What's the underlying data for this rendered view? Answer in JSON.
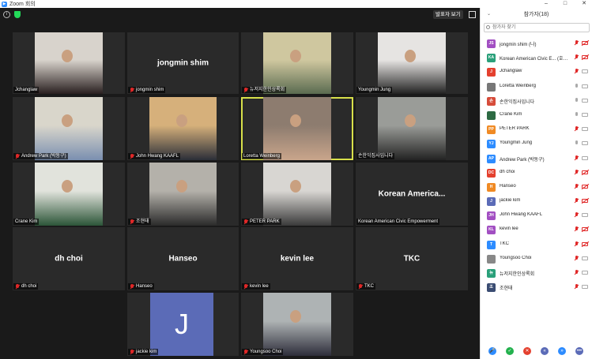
{
  "window": {
    "title": "Zoom 회의",
    "controls": [
      "–",
      "□",
      "✕"
    ]
  },
  "toolbar": {
    "speaker_view_label": "발표자 보기"
  },
  "tiles": [
    {
      "name": "Jchanglaw",
      "big": "",
      "muted": false,
      "photo_color": "#d8d3cc",
      "photo2": "#2a2020"
    },
    {
      "name": "jongmin shim",
      "big": "jongmin shim",
      "muted": true
    },
    {
      "name": "뉴저지한인상록회",
      "big": "",
      "muted": true,
      "photo_color": "#cfc79f",
      "photo2": "#5a6b50"
    },
    {
      "name": "Youngmin Jung",
      "big": "",
      "muted": false,
      "photo_color": "#e6e4e2",
      "photo2": "#222"
    },
    {
      "name": "Andrew Park (박동구)",
      "big": "",
      "muted": true,
      "photo_color": "#d9d6cb",
      "photo2": "#7a8fb0"
    },
    {
      "name": "John Hwang KAAFL",
      "big": "",
      "muted": true,
      "photo_color": "#d6b07b",
      "photo2": "#2a2e38"
    },
    {
      "name": "Loretta Weinberg",
      "big": "",
      "muted": false,
      "photo_color": "#8d7c6f",
      "photo2": "#c9a58b"
    },
    {
      "name": "손한익집사입니다",
      "big": "",
      "muted": false,
      "photo_color": "#9a9c98",
      "photo2": "#222"
    },
    {
      "name": "Crane Kim",
      "big": "",
      "muted": false,
      "photo_color": "#e1e3dc",
      "photo2": "#2c5538"
    },
    {
      "name": "조현태",
      "big": "",
      "muted": true,
      "photo_color": "#b4b1aa",
      "photo2": "#2a2a2a"
    },
    {
      "name": "PETER PARK",
      "big": "",
      "muted": true,
      "photo_color": "#d8d6d2",
      "photo2": "#3a3a3a"
    },
    {
      "name": "Korean American Civic Empowerment",
      "big": "Korean  America...",
      "muted": false
    },
    {
      "name": "dh choi",
      "big": "dh choi",
      "muted": true
    },
    {
      "name": "Hanseo",
      "big": "Hanseo",
      "muted": true
    },
    {
      "name": "kevin lee",
      "big": "kevin lee",
      "muted": true
    },
    {
      "name": "TKC",
      "big": "TKC",
      "muted": true
    },
    {
      "name": "jackie kim",
      "big": "",
      "muted": true,
      "avatar_letter": "J",
      "avatar_color": "#5b6bb7"
    },
    {
      "name": "Youngsoo Choi",
      "big": "",
      "muted": true,
      "photo_color": "#aeb3b4",
      "photo2": "#2d2d3a"
    }
  ],
  "panel": {
    "title": "참가자(18)",
    "search_placeholder": "참가자 찾기",
    "participants": [
      {
        "initials": "JS",
        "color": "#a24fc2",
        "name": "jongmin shim (나)",
        "mic_muted": true,
        "cam_off": true
      },
      {
        "initials": "KA",
        "color": "#2aa07a",
        "name": "Korean American Civic E... (호스트)",
        "mic_muted": true,
        "cam_off": true
      },
      {
        "initials": "J",
        "color": "#e4402e",
        "name": "Jchanglaw",
        "mic_muted": true,
        "cam_off": false
      },
      {
        "initials": "",
        "color": "#777777",
        "name": "Loretta Weinberg",
        "mic_muted": false,
        "cam_off": false
      },
      {
        "initials": "손",
        "color": "#d64c3a",
        "name": "손한익집사입니다",
        "mic_muted": false,
        "cam_off": false
      },
      {
        "initials": "",
        "color": "#2d6a43",
        "name": "Crane Kim",
        "mic_muted": false,
        "cam_off": false
      },
      {
        "initials": "PP",
        "color": "#f08a24",
        "name": "PETER PARK",
        "mic_muted": true,
        "cam_off": false
      },
      {
        "initials": "YJ",
        "color": "#2d8cff",
        "name": "Youngmin Jung",
        "mic_muted": false,
        "cam_off": false
      },
      {
        "initials": "AP",
        "color": "#2d8cff",
        "name": "Andrew Park (박동구)",
        "mic_muted": true,
        "cam_off": false
      },
      {
        "initials": "DC",
        "color": "#e4402e",
        "name": "dh choi",
        "mic_muted": true,
        "cam_off": true
      },
      {
        "initials": "H",
        "color": "#f08a24",
        "name": "Hanseo",
        "mic_muted": true,
        "cam_off": true
      },
      {
        "initials": "J",
        "color": "#5b6bb7",
        "name": "jackie kim",
        "mic_muted": true,
        "cam_off": true
      },
      {
        "initials": "JH",
        "color": "#a24fc2",
        "name": "John Hwang KAAFL",
        "mic_muted": true,
        "cam_off": false
      },
      {
        "initials": "KL",
        "color": "#a24fc2",
        "name": "kevin lee",
        "mic_muted": true,
        "cam_off": true
      },
      {
        "initials": "T",
        "color": "#2d8cff",
        "name": "TKC",
        "mic_muted": true,
        "cam_off": true
      },
      {
        "initials": "",
        "color": "#888888",
        "name": "Youngsoo Choi",
        "mic_muted": true,
        "cam_off": false
      },
      {
        "initials": "뉴",
        "color": "#2aa07a",
        "name": "뉴저지한인상록회",
        "mic_muted": true,
        "cam_off": false
      },
      {
        "initials": "조",
        "color": "#3a4c72",
        "name": "조현태",
        "mic_muted": true,
        "cam_off": false
      }
    ],
    "footer_buttons": [
      {
        "icon": "mic-icon",
        "color": "#2d8cff",
        "glyph": "🎤"
      },
      {
        "icon": "check-icon",
        "color": "#23b14d",
        "glyph": "✓"
      },
      {
        "icon": "x-icon",
        "color": "#e4402e",
        "glyph": "✕"
      },
      {
        "icon": "rewind-icon",
        "color": "#5b6bb7",
        "glyph": "«"
      },
      {
        "icon": "forward-icon",
        "color": "#2d8cff",
        "glyph": "»"
      },
      {
        "icon": "more-icon",
        "color": "#5b6bb7",
        "glyph": "•••"
      }
    ]
  }
}
